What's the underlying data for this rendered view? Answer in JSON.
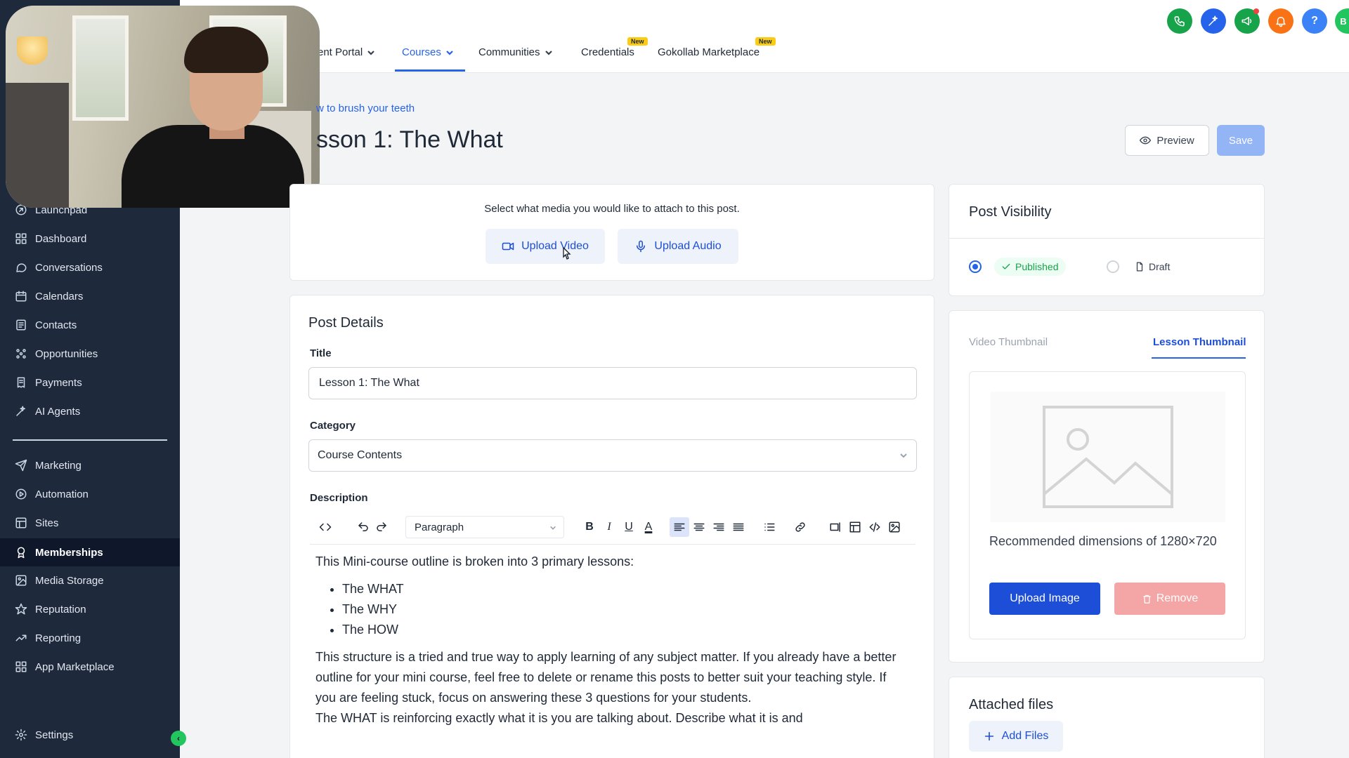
{
  "sidebar": {
    "items": [
      {
        "label": "Launchpad",
        "icon": "launchpad-icon"
      },
      {
        "label": "Dashboard",
        "icon": "dashboard-icon"
      },
      {
        "label": "Conversations",
        "icon": "chat-icon"
      },
      {
        "label": "Calendars",
        "icon": "calendar-icon"
      },
      {
        "label": "Contacts",
        "icon": "contacts-icon"
      },
      {
        "label": "Opportunities",
        "icon": "opportunities-icon"
      },
      {
        "label": "Payments",
        "icon": "payments-icon"
      },
      {
        "label": "AI Agents",
        "icon": "ai-agents-icon"
      },
      {
        "label": "Marketing",
        "icon": "send-icon"
      },
      {
        "label": "Automation",
        "icon": "automation-icon"
      },
      {
        "label": "Sites",
        "icon": "sites-icon"
      },
      {
        "label": "Memberships",
        "icon": "memberships-icon",
        "active": true
      },
      {
        "label": "Media Storage",
        "icon": "image-icon"
      },
      {
        "label": "Reputation",
        "icon": "star-icon"
      },
      {
        "label": "Reporting",
        "icon": "trend-icon"
      },
      {
        "label": "App Marketplace",
        "icon": "grid-icon"
      }
    ],
    "settings_label": "Settings",
    "collapse_glyph": "‹"
  },
  "topnav": {
    "items": [
      {
        "label": "ent Portal"
      },
      {
        "label": "Courses",
        "active": true
      },
      {
        "label": "Communities"
      },
      {
        "label": "Credentials"
      },
      {
        "label": "Gokollab Marketplace"
      }
    ],
    "new_badge": "New",
    "icons": [
      "phone-icon",
      "magic-icon",
      "megaphone-icon",
      "bell-icon",
      "help-icon"
    ],
    "help_glyph": "?",
    "avatar_initial": "B",
    "colors": {
      "phone": "#16a34a",
      "magic": "#2563eb",
      "megaphone": "#16a34a",
      "bell": "#f97316",
      "help": "#3b82f6",
      "avatar": "#22c55e"
    }
  },
  "header": {
    "breadcrumb": "w to brush your teeth",
    "title": "sson 1: The What",
    "preview_label": "Preview",
    "save_label": "Save"
  },
  "media": {
    "prompt": "Select what media you would like to attach to this post.",
    "upload_video_label": "Upload Video",
    "upload_audio_label": "Upload Audio"
  },
  "post_details": {
    "section_title": "Post Details",
    "title_label": "Title",
    "title_value": "Lesson 1: The What",
    "category_label": "Category",
    "category_value": "Course Contents",
    "description_label": "Description",
    "paragraph_format": "Paragraph",
    "toolbar_text": {
      "bold": "B",
      "italic": "I",
      "underline": "U",
      "font_color": "A"
    },
    "description": {
      "intro": "This Mini-course outline is broken into 3 primary lessons:",
      "bullets": [
        "The WHAT",
        "The WHY",
        "The HOW"
      ],
      "paragraph": "This structure is a tried and true way to apply learning of any subject matter. If you already have a better outline for your mini course, feel free to delete or rename this posts to better suit your teaching style. If you are feeling stuck, focus on answering these 3 questions for your students.",
      "paragraph2": "The WHAT is reinforcing exactly what it is you are talking about. Describe what it is and"
    }
  },
  "visibility": {
    "title": "Post Visibility",
    "published_label": "Published",
    "draft_label": "Draft",
    "selected": "published"
  },
  "thumbnail": {
    "tab_video": "Video Thumbnail",
    "tab_lesson": "Lesson Thumbnail",
    "active_tab": "lesson",
    "recommended_text": "Recommended dimensions of 1280×720",
    "upload_label": "Upload Image",
    "remove_label": "Remove"
  },
  "files": {
    "title": "Attached files",
    "add_label": "Add Files"
  }
}
